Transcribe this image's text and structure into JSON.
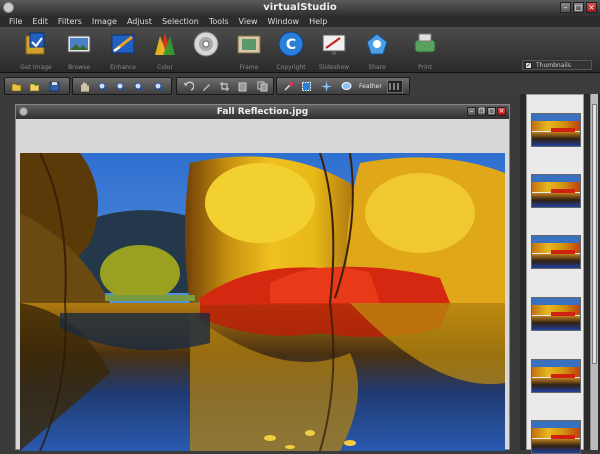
{
  "app": {
    "title": "virtualStudio"
  },
  "menu": [
    "File",
    "Edit",
    "Filters",
    "Image",
    "Adjust",
    "Selection",
    "Tools",
    "View",
    "Window",
    "Help"
  ],
  "tools": [
    {
      "name": "get-image",
      "label": "Get Image"
    },
    {
      "name": "browse",
      "label": "Browse"
    },
    {
      "name": "enhance",
      "label": "Enhance"
    },
    {
      "name": "color",
      "label": "Color"
    },
    {
      "name": "effects",
      "label": ""
    },
    {
      "name": "frame",
      "label": "Frame"
    },
    {
      "name": "copyright",
      "label": "Copyright"
    },
    {
      "name": "slideshow",
      "label": "Slideshow"
    },
    {
      "name": "share",
      "label": "Share"
    },
    {
      "name": "print",
      "label": "Print"
    }
  ],
  "thumbnails_toggle": {
    "label": "Thumbnails",
    "checked": true
  },
  "toolbar2": {
    "feather_label": "Feather"
  },
  "document": {
    "title": "Fall Reflection.jpg"
  },
  "thumbnails_count": 6,
  "colors": {
    "accent_blue": "#2a7fd8",
    "window_dark": "#2e2e2e",
    "close_red": "#c02020"
  }
}
